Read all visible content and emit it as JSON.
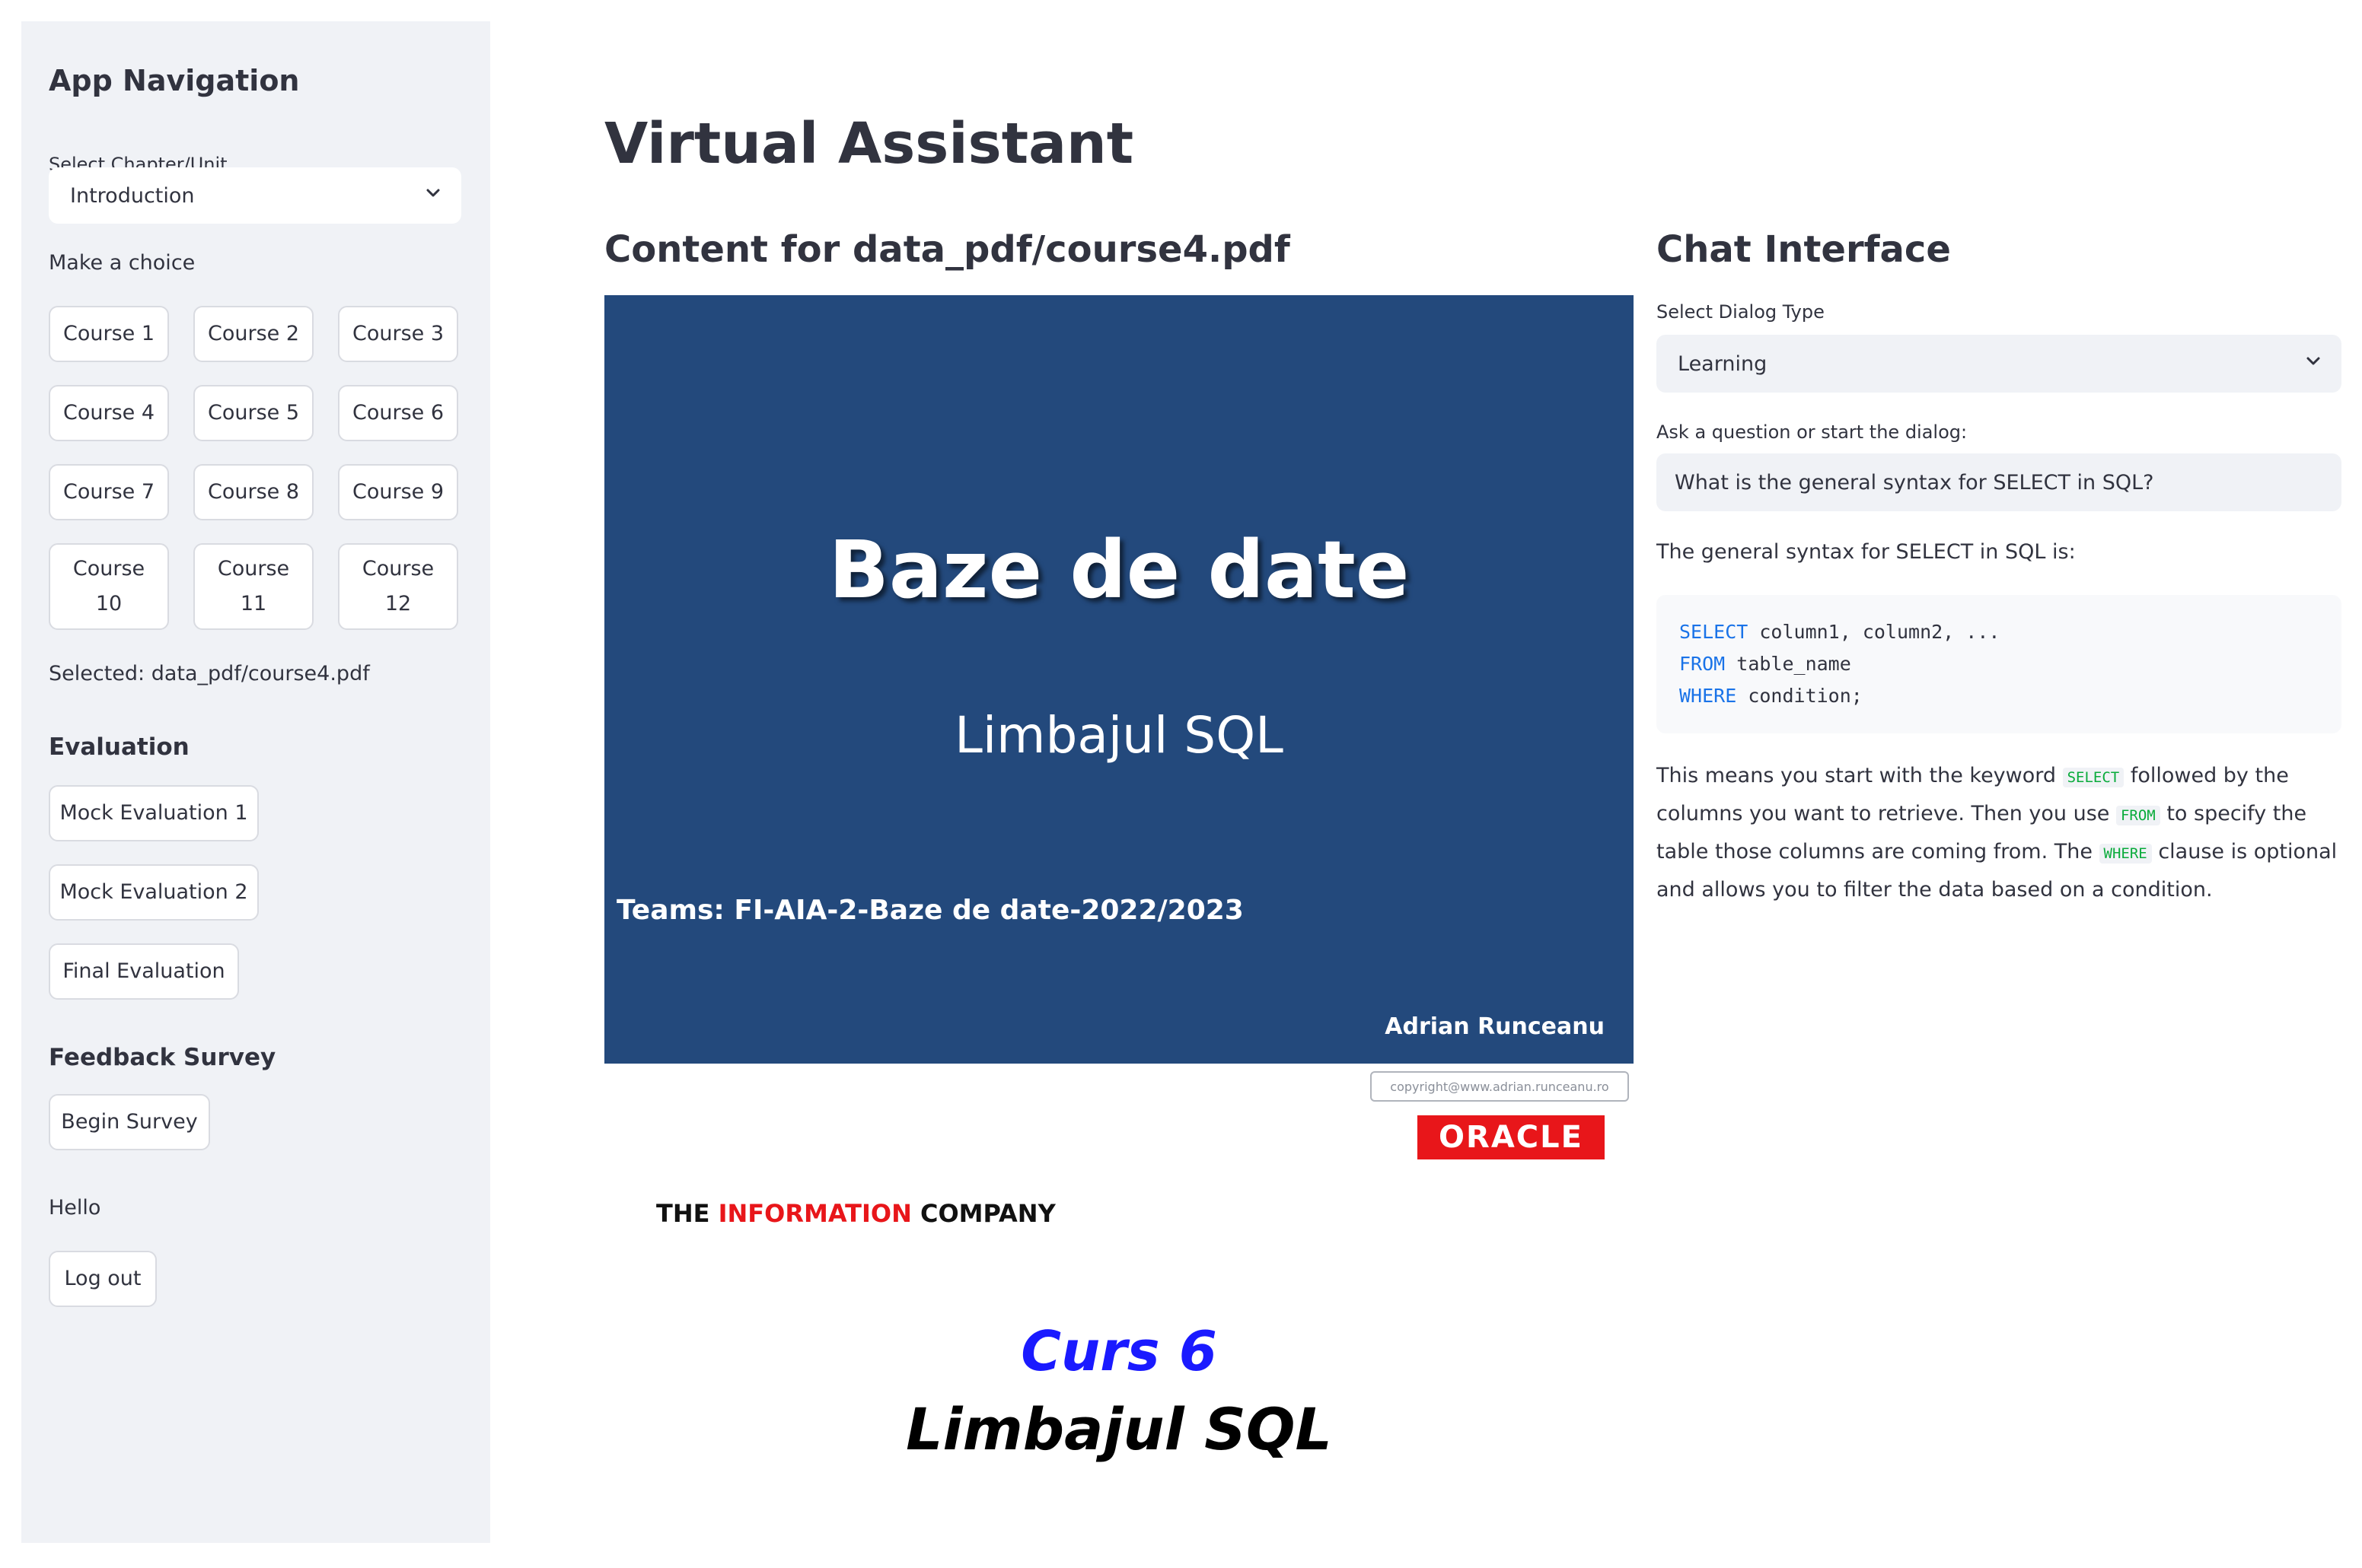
{
  "sidebar": {
    "title": "App Navigation",
    "chapter_label": "Select Chapter/Unit",
    "chapter_value": "Introduction",
    "choice_label": "Make a choice",
    "courses": [
      {
        "l1": "Course 1"
      },
      {
        "l1": "Course 2"
      },
      {
        "l1": "Course 3"
      },
      {
        "l1": "Course 4"
      },
      {
        "l1": "Course 5"
      },
      {
        "l1": "Course 6"
      },
      {
        "l1": "Course 7"
      },
      {
        "l1": "Course 8"
      },
      {
        "l1": "Course 9"
      },
      {
        "l1": "Course",
        "l2": "10"
      },
      {
        "l1": "Course",
        "l2": "11"
      },
      {
        "l1": "Course",
        "l2": "12"
      }
    ],
    "selected_text": "Selected: data_pdf/course4.pdf",
    "evaluation_heading": "Evaluation",
    "evaluation_buttons": [
      "Mock Evaluation 1",
      "Mock Evaluation 2",
      "Final Evaluation"
    ],
    "feedback_heading": "Feedback Survey",
    "survey_button": "Begin Survey",
    "hello_text": "Hello",
    "logout_button": "Log out"
  },
  "main": {
    "title": "Virtual Assistant",
    "content_heading": "Content for data_pdf/course4.pdf",
    "slide": {
      "title": "Baze de date",
      "subtitle": "Limbajul SQL",
      "teams": "Teams: FI-AIA-2-Baze de date-2022/2023",
      "author": "Adrian Runceanu"
    },
    "copyright": "copyright@www.adrian.runceanu.ro",
    "oracle_logo": "ORACLE",
    "tagline": {
      "part1": "THE ",
      "part2": "INFORMATION",
      "part3": " COMPANY"
    },
    "curs": "Curs 6",
    "curs_subtitle": "Limbajul SQL"
  },
  "chat": {
    "heading": "Chat Interface",
    "dialog_label": "Select Dialog Type",
    "dialog_value": "Learning",
    "question_label": "Ask a question or start the dialog:",
    "question_value": "What is the general syntax for SELECT in SQL?",
    "answer_intro": "The general syntax for SELECT in SQL is:",
    "code": [
      {
        "kw": "SELECT",
        "rest": " column1, column2, ..."
      },
      {
        "kw": "FROM",
        "rest": " table_name"
      },
      {
        "kw": "WHERE",
        "rest": " condition;"
      }
    ],
    "para": {
      "t1": "This means you start with the keyword ",
      "c1": "SELECT",
      "t2": " followed by the columns you want to retrieve. Then you use ",
      "c2": "FROM",
      "t3": " to specify the table those columns are coming from. The ",
      "c3": "WHERE",
      "t4": " clause is optional and allows you to filter the data based on a condition."
    }
  },
  "colors": {
    "sidebar_bg": "#f0f2f6",
    "slide_bg": "#23497c",
    "oracle_red": "#e8161a",
    "curs_blue": "#1a1aff",
    "code_keyword": "#1a73e8",
    "inline_code": "#09ab3b"
  },
  "icons": {
    "select_chevron": "chevron-down-icon"
  }
}
